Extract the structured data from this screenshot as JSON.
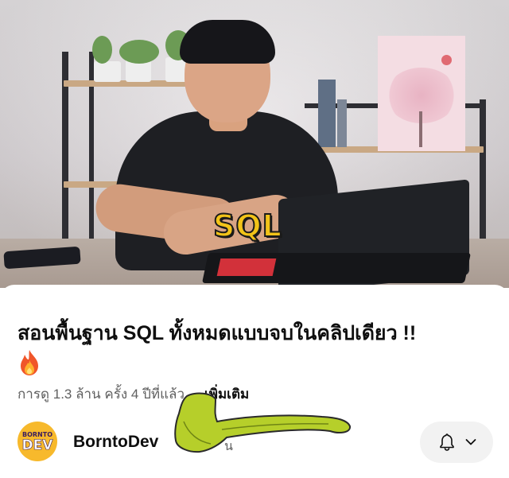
{
  "video": {
    "caption": "SQL"
  },
  "video_info": {
    "title": "สอนพื้นฐาน SQL ทั้งหมดแบบจบในคลิปเดียว !!",
    "title_emoji_icon": "fire-icon",
    "views_and_age": "การดู 1.3 ล้าน ครั้ง  4 ปีที่แล้ว",
    "more_label": "...เพิ่มเติม"
  },
  "channel": {
    "avatar_top": "BORNTO",
    "avatar_bottom": "DEV",
    "name": "BorntoDev",
    "subscribers_partial": "น",
    "subscribe_icon": "bell-icon",
    "dropdown_icon": "chevron-down-icon"
  },
  "colors": {
    "caption_yellow": "#f2c318",
    "arrow_green": "#b6cf2a",
    "avatar_bg": "#f7b92c"
  }
}
